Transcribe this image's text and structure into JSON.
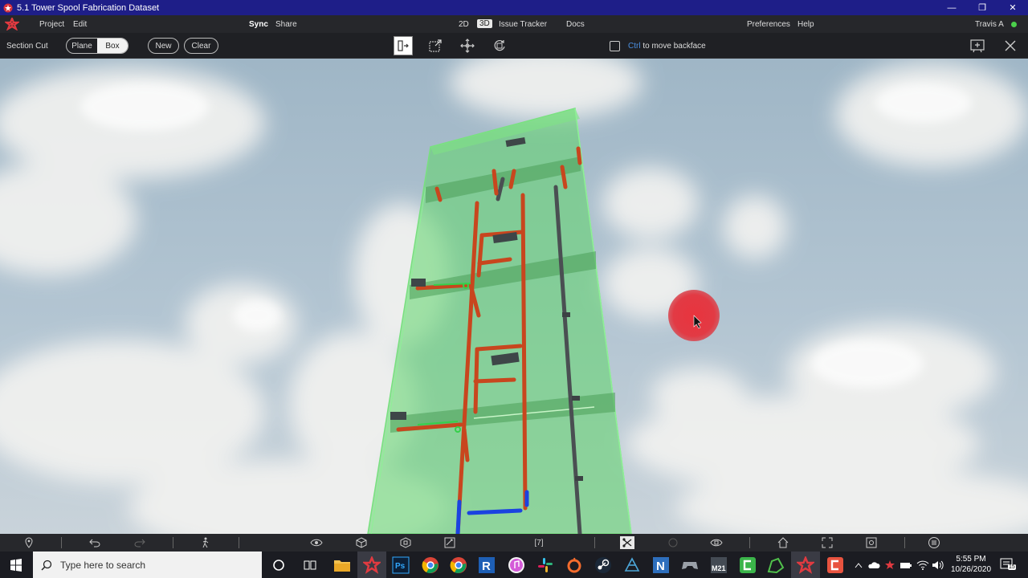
{
  "window": {
    "title": "5.1 Tower Spool Fabrication Dataset",
    "minimize": "—",
    "maximize": "❐",
    "close": "✕"
  },
  "menu": {
    "project": "Project",
    "edit": "Edit",
    "sync": "Sync",
    "share": "Share",
    "view_2d": "2D",
    "view_3d": "3D",
    "issue_tracker": "Issue Tracker",
    "docs": "Docs",
    "preferences": "Preferences",
    "help": "Help",
    "user": "Travis A",
    "status_color": "#4bd04b"
  },
  "section_toolbar": {
    "label": "Section Cut",
    "mode_plane": "Plane",
    "mode_box": "Box",
    "active_mode": "Box",
    "new_label": "New",
    "clear_label": "Clear",
    "tools": [
      "section-cut-icon",
      "resize-box-icon",
      "move-icon",
      "rotate-icon"
    ],
    "backface_checked": false,
    "hint_key": "Ctrl",
    "hint_text": " to move backface",
    "add_view": "add-view-icon",
    "close": "close-icon"
  },
  "viewport": {
    "section_box_color": "#5fd66a",
    "pipe_color": "#c8461e",
    "gray_pipe_color": "#4a4f52",
    "blue_pipe_color": "#1b43e0",
    "cursor_marker_color": "#e6303a"
  },
  "bottom_toolbar": {
    "page_indicator": "[7]",
    "icons": [
      "location-icon",
      "undo-icon",
      "redo-icon",
      "walk-icon",
      "eye-icon",
      "box-icon",
      "layers-icon",
      "markup-icon",
      "page-icon",
      "crop-section-icon",
      "focus-icon",
      "view-cube-icon",
      "home-icon",
      "fullscreen-icon",
      "frame-icon",
      "menu-icon"
    ]
  },
  "taskbar": {
    "search_placeholder": "Type here to search",
    "time": "5:55 PM",
    "date": "10/26/2020",
    "notification_count": "15"
  }
}
